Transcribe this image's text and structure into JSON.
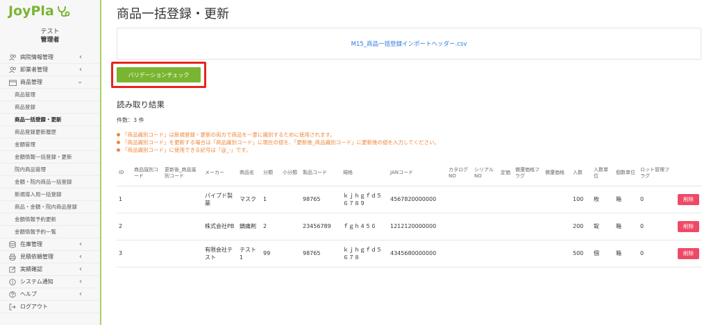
{
  "sidebar": {
    "logo_text": "JoyPla",
    "user_name": "テスト",
    "user_role": "管理者",
    "nav": [
      {
        "label": "病院情報管理",
        "icon": "users-icon",
        "open": false
      },
      {
        "label": "卸業者管理",
        "icon": "users-icon",
        "open": false
      },
      {
        "label": "商品管理",
        "icon": "box-icon",
        "open": true
      }
    ],
    "sub_items": [
      "商品管理",
      "商品登録",
      "商品一括登録・更新",
      "商品登録更新履歴",
      "金額管理",
      "金額情報一括登録・更新",
      "院内商品管理",
      "金額・院内商品一括登録",
      "新規導入用一括登録",
      "商品・金額・院内商品登録",
      "金額情報予約更新",
      "金額情報予約一覧"
    ],
    "nav_bottom": [
      {
        "label": "在庫管理",
        "icon": "database-icon"
      },
      {
        "label": "見積依頼管理",
        "icon": "printer-icon"
      },
      {
        "label": "実績確認",
        "icon": "edit-icon"
      },
      {
        "label": "システム通知",
        "icon": "info-icon"
      },
      {
        "label": "ヘルプ",
        "icon": "question-icon"
      },
      {
        "label": "ログアウト",
        "icon": "logout-icon"
      }
    ]
  },
  "main": {
    "title": "商品一括登録・更新",
    "file_name": "M15_商品一括登録インポートヘッダー.csv",
    "validate_label": "バリデーションチェック",
    "result_title": "読み取り結果",
    "count_text": "件数：3 件",
    "notes": [
      "「商品識別コード」は新規登録・更新の両方で商品を一意に識別するために使用されます。",
      "「商品識別コード」を更新する場合は「商品識別コード」に現在の値を、「更新後_商品識別コード」に更新後の値を入力してください。",
      "「商品識別コード」に使用できる記号は「@_-」です。"
    ],
    "table": {
      "headers": [
        "ID",
        "商品識別コード",
        "更新後_商品識別コード",
        "メーカー",
        "商品名",
        "分類",
        "小分類",
        "製品コード",
        "規格",
        "JANコード",
        "カタログNO",
        "シリアルNO",
        "定価",
        "償還価格フラグ",
        "償還価格",
        "入数",
        "入数単位",
        "個数単位",
        "ロット管理フラグ",
        ""
      ],
      "rows": [
        [
          "1",
          "",
          "",
          "パイプド製薬",
          "マスク",
          "1",
          "",
          "98765",
          "ｋｊｈｇｆｄ５６７８９",
          "4567820000000",
          "",
          "",
          "",
          "",
          "",
          "100",
          "枚",
          "箱",
          "0",
          "削除"
        ],
        [
          "2",
          "",
          "",
          "株式会社PB",
          "鎮痛剤",
          "2",
          "",
          "23456789",
          "ｆｇｈ４５６",
          "1212120000000",
          "",
          "",
          "",
          "",
          "",
          "200",
          "錠",
          "箱",
          "0",
          "削除"
        ],
        [
          "3",
          "",
          "",
          "有限会社テスト",
          "テスト1",
          "99",
          "",
          "98765",
          "ｋｊｈｇｆｄ５６７８",
          "4345680000000",
          "",
          "",
          "",
          "",
          "",
          "500",
          "個",
          "箱",
          "0",
          "削除"
        ]
      ]
    }
  },
  "colors": {
    "brand_green": "#7ab531",
    "highlight_red": "#e8231c",
    "note_orange": "#f0873a",
    "delete_pink": "#ee4a66",
    "link_blue": "#2a7ae2"
  }
}
